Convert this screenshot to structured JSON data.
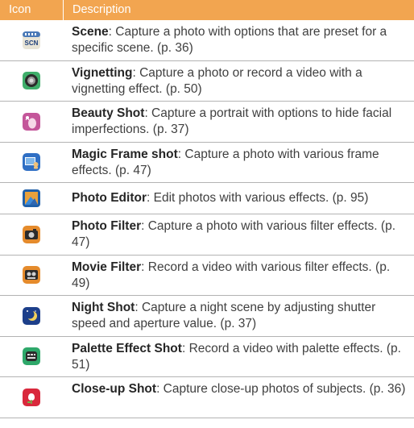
{
  "header": {
    "icon_col": "Icon",
    "desc_col": "Description"
  },
  "rows": [
    {
      "icon": "scene-mode-icon",
      "name": "Scene",
      "desc": ": Capture a photo with options that are preset for a specific scene. (p. 36)"
    },
    {
      "icon": "vignetting-icon",
      "name": "Vignetting",
      "desc": ": Capture a photo or record a video with a vignetting effect. (p. 50)"
    },
    {
      "icon": "beauty-shot-icon",
      "name": "Beauty Shot",
      "desc": ": Capture a portrait with options to hide facial imperfections. (p. 37)"
    },
    {
      "icon": "magic-frame-icon",
      "name": "Magic Frame shot",
      "desc": ": Capture a photo with various frame effects. (p. 47)"
    },
    {
      "icon": "photo-editor-icon",
      "name": "Photo Editor",
      "desc": ": Edit photos with various effects. (p. 95)"
    },
    {
      "icon": "photo-filter-icon",
      "name": "Photo Filter",
      "desc": ": Capture a photo with various filter effects. (p. 47)"
    },
    {
      "icon": "movie-filter-icon",
      "name": "Movie Filter",
      "desc": ": Record a video with various filter effects. (p. 49)"
    },
    {
      "icon": "night-shot-icon",
      "name": "Night Shot",
      "desc": ": Capture a night scene by adjusting shutter speed and aperture value. (p. 37)"
    },
    {
      "icon": "palette-effect-icon",
      "name": "Palette Effect Shot",
      "desc": ": Record a video with palette effects. (p. 51)"
    },
    {
      "icon": "close-up-icon",
      "name": "Close-up Shot",
      "desc": ": Capture close-up photos of subjects. (p. 36)"
    }
  ],
  "icon_labels": {
    "scene": "SCN"
  }
}
